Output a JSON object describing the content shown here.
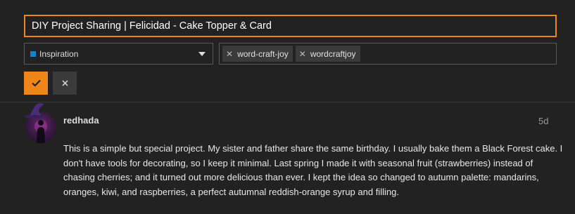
{
  "editor": {
    "title_value": "DIY Project Sharing | Felicidad - Cake Topper & Card",
    "category": {
      "label": "Inspiration",
      "color": "#0e84d3"
    },
    "tags": [
      "word-craft-joy",
      "wordcraftjoy"
    ],
    "save_icon": "check-icon",
    "cancel_icon": "close-icon"
  },
  "post": {
    "username": "redhada",
    "date": "5d",
    "body": "This is a simple but special project. My sister and father share the same birthday. I usually bake them a Black Forest cake. I don't have tools for decorating, so I keep it minimal. Last spring I made it with seasonal fruit (strawberries) instead of chasing cherries; and it turned out more delicious than ever. I kept the idea so changed to autumn palette: mandarins, oranges, kiwi, and raspberries, a perfect autumnal reddish-orange syrup and filling."
  },
  "colors": {
    "accent": "#f0861a",
    "background": "#222222"
  }
}
